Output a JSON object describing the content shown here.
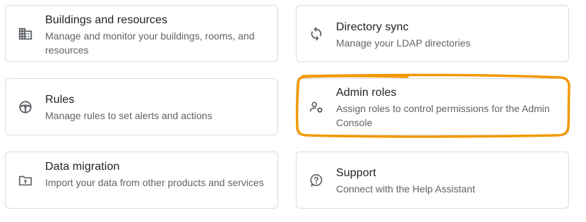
{
  "cards": [
    {
      "title": "Buildings and resources",
      "desc": "Manage and monitor your buildings, rooms, and resources",
      "icon": "building-icon"
    },
    {
      "title": "Directory sync",
      "desc": "Manage your LDAP directories",
      "icon": "sync-icon"
    },
    {
      "title": "Rules",
      "desc": "Manage rules to set alerts and actions",
      "icon": "steering-wheel-icon"
    },
    {
      "title": "Admin roles",
      "desc": "Assign roles to control permissions for the Admin Console",
      "icon": "admin-roles-icon"
    },
    {
      "title": "Data migration",
      "desc": "Import your data from other products and services",
      "icon": "folder-upload-icon"
    },
    {
      "title": "Support",
      "desc": "Connect with the Help Assistant",
      "icon": "help-icon"
    }
  ],
  "colors": {
    "highlight": "#f29900",
    "icon": "#5f6368",
    "border": "#dadce0"
  }
}
